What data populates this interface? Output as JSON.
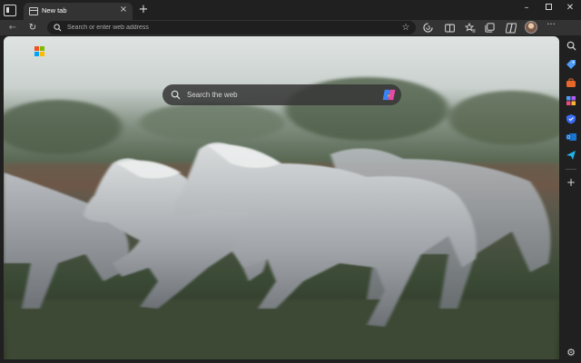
{
  "window": {
    "tab": {
      "title": "New tab",
      "close_glyph": "×"
    },
    "new_tab_glyph": "+",
    "controls": {
      "minimize_glyph": "–",
      "close_glyph": "✕"
    }
  },
  "toolbar": {
    "back_glyph": "←",
    "refresh_glyph": "↻",
    "address_placeholder": "Search or enter web address",
    "favorite_glyph": "☆",
    "more_glyph": "···"
  },
  "newtab": {
    "search_placeholder": "Search the web",
    "background": "white horses galloping (motion blur)"
  },
  "sidebar": {
    "items": [
      {
        "name": "search-icon"
      },
      {
        "name": "tag-icon"
      },
      {
        "name": "briefcase-icon"
      },
      {
        "name": "games-icon"
      },
      {
        "name": "shield-icon"
      },
      {
        "name": "outlook-icon"
      },
      {
        "name": "send-icon"
      }
    ],
    "add_glyph": "+",
    "settings_glyph": "⚙"
  },
  "colors": {
    "frame": "#202020",
    "toolbar": "#333333",
    "address_bg": "#1f1f1f",
    "ms_red": "#f25022",
    "ms_green": "#7fba00",
    "ms_blue": "#00a4ef",
    "ms_yellow": "#ffb900"
  }
}
